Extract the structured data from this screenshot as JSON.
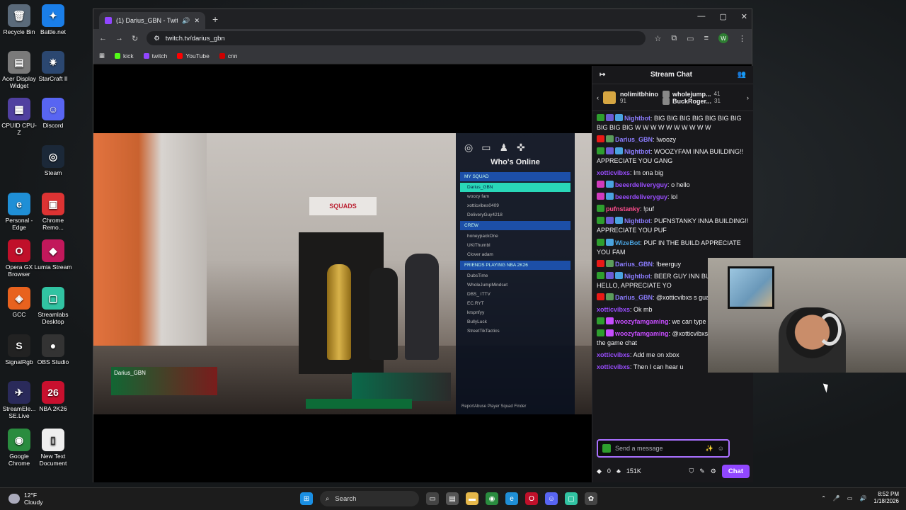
{
  "desktop_icons": [
    {
      "label": "Recycle Bin",
      "glyph": "🗑",
      "color": "#5a6a7a"
    },
    {
      "label": "Battle.net",
      "glyph": "✦",
      "color": "#1a7ee8"
    },
    {
      "label": "Acer Display Widget",
      "glyph": "▤",
      "color": "#7a7a7a"
    },
    {
      "label": "StarCraft II",
      "glyph": "✷",
      "color": "#2b4770"
    },
    {
      "label": "CPUID CPU-Z",
      "glyph": "▦",
      "color": "#5040a0"
    },
    {
      "label": "Discord",
      "glyph": "☺",
      "color": "#5865f2"
    },
    {
      "label": "Steam",
      "glyph": "◎",
      "color": "#1b2838"
    },
    {
      "label": "Personal - Edge",
      "glyph": "e",
      "color": "#1f8fd6"
    },
    {
      "label": "Chrome Remo...",
      "glyph": "▣",
      "color": "#d33"
    },
    {
      "label": "Opera GX Browser",
      "glyph": "O",
      "color": "#c0102a"
    },
    {
      "label": "Lumia Stream",
      "glyph": "◆",
      "color": "#c2185b"
    },
    {
      "label": "GCC",
      "glyph": "◈",
      "color": "#e8621e"
    },
    {
      "label": "Streamlabs Desktop",
      "glyph": "▢",
      "color": "#31c3a2"
    },
    {
      "label": "SignalRgb",
      "glyph": "S",
      "color": "#222"
    },
    {
      "label": "OBS Studio",
      "glyph": "●",
      "color": "#333"
    },
    {
      "label": "StreamEle... SE.Live",
      "glyph": "✈",
      "color": "#2a2a5a"
    },
    {
      "label": "NBA 2K26",
      "glyph": "26",
      "color": "#c8102e"
    },
    {
      "label": "Google Chrome",
      "glyph": "◉",
      "color": "#2a8c3f"
    },
    {
      "label": "New Text Document",
      "glyph": "▯",
      "color": "#eee"
    }
  ],
  "browser": {
    "tab_title": "(1) Darius_GBN - Twitch",
    "new_tab": "+",
    "url": "twitch.tv/darius_gbn",
    "profile_initial": "W",
    "bookmarks": [
      {
        "label": "kick",
        "color": "#53fc18"
      },
      {
        "label": "twitch",
        "color": "#9146ff"
      },
      {
        "label": "YouTube",
        "color": "#ff0000"
      },
      {
        "label": "cnn",
        "color": "#cc0000"
      }
    ]
  },
  "game": {
    "sign_text": "SQUADS",
    "panel_title": "Who's Online",
    "sections": [
      "MY SQUAD",
      "CREW",
      "FRIENDS PLAYING NBA 2K26"
    ],
    "squad_rows": [
      "Darius_GBN",
      "woozy fam",
      "xotticvibes0409",
      "DeliveryGuy4218"
    ],
    "crew_rows": [
      "honeypackOne",
      "UKIThumbl",
      "Clover adam"
    ],
    "friend_rows": [
      "DubsTime",
      "WholeJumpMindset",
      "DBS_ ITTV",
      "EC.RYT",
      "krspnfyy",
      "BullyLuck",
      "StreetTikTactics"
    ],
    "footer": "ReportAbuse Player   Squad Finder",
    "hud_name": "Darius_GBN"
  },
  "chat": {
    "title": "Stream Chat",
    "gifts": [
      {
        "name": "nolimitbhino",
        "count": "91"
      },
      {
        "name": "wholejump...",
        "count": "41"
      },
      {
        "name": "BuckRoger...",
        "count": "31"
      }
    ],
    "messages": [
      {
        "user": "Nightbot",
        "color": "#8c7dff",
        "text": "BIG BIG BIG BIG BIG BIG BIG BIG BIG BIG W W W W W W W W W W",
        "badges": [
          "#2e9e2e",
          "#6b5bd3",
          "#4aa3df"
        ]
      },
      {
        "user": "Darius_GBN",
        "color": "#8c7dff",
        "text": "!woozy",
        "badges": [
          "#e91916",
          "#5b9c5b"
        ]
      },
      {
        "user": "Nightbot",
        "color": "#8c7dff",
        "text": "WOOZYFAM INNA BUILDING!! APPRECIATE YOU GANG",
        "badges": [
          "#2e9e2e",
          "#6b5bd3",
          "#4aa3df"
        ]
      },
      {
        "user": "xotticvibxs",
        "color": "#9a4dff",
        "text": "Im ona big",
        "badges": []
      },
      {
        "user": "beeerdeliveryguy",
        "color": "#9a4dff",
        "text": "o hello",
        "badges": [
          "#d13abd",
          "#4aa3df"
        ]
      },
      {
        "user": "beeerdeliveryguy",
        "color": "#9a4dff",
        "text": "lol",
        "badges": [
          "#d13abd",
          "#4aa3df"
        ]
      },
      {
        "user": "pufnstanky",
        "color": "#ff4d8d",
        "text": "!puf",
        "badges": [
          "#2e9e2e"
        ]
      },
      {
        "user": "Nightbot",
        "color": "#8c7dff",
        "text": "PUFNSTANKY INNA BUILDING!! APPRECIATE YOU PUF",
        "badges": [
          "#2e9e2e",
          "#6b5bd3",
          "#4aa3df"
        ]
      },
      {
        "user": "WizeBot",
        "color": "#4aa3df",
        "text": "PUF IN THE BUILD APPRECIATE YOU FAM",
        "badges": [
          "#2e9e2e",
          "#4aa3df"
        ]
      },
      {
        "user": "Darius_GBN",
        "color": "#8c7dff",
        "text": "!beerguy",
        "badges": [
          "#e91916",
          "#5b9c5b"
        ]
      },
      {
        "user": "Nightbot",
        "color": "#8c7dff",
        "text": "BEER GUY INN BUILDING!! HELLO, APPRECIATE YO",
        "badges": [
          "#2e9e2e",
          "#6b5bd3",
          "#4aa3df"
        ]
      },
      {
        "user": "Darius_GBN",
        "color": "#8c7dff",
        "text": "@xotticvibxs s guard",
        "badges": [
          "#e91916",
          "#5b9c5b"
        ]
      },
      {
        "user": "xotticvibxs",
        "color": "#9a4dff",
        "text": "Ok mb",
        "badges": []
      },
      {
        "user": "woozyfamgaming",
        "color": "#c74dff",
        "text": "we can type here",
        "badges": [
          "#2e9e2e",
          "#c74dff"
        ]
      },
      {
        "user": "woozyfamgaming",
        "color": "#c74dff",
        "text": "@xotticvibxs cant hear in the game chat",
        "badges": [
          "#2e9e2e",
          "#c74dff"
        ]
      },
      {
        "user": "xotticvibxs",
        "color": "#9a4dff",
        "text": "Add me on xbox",
        "badges": []
      },
      {
        "user": "xotticvibxs",
        "color": "#9a4dff",
        "text": "Then I can hear u",
        "badges": []
      }
    ],
    "input_placeholder": "Send a message",
    "bits": "0",
    "points": "151K",
    "chat_button": "Chat"
  },
  "taskbar": {
    "temp": "12°F",
    "condition": "Cloudy",
    "search": "Search",
    "time": "8:52 PM",
    "date": "1/18/2026"
  }
}
